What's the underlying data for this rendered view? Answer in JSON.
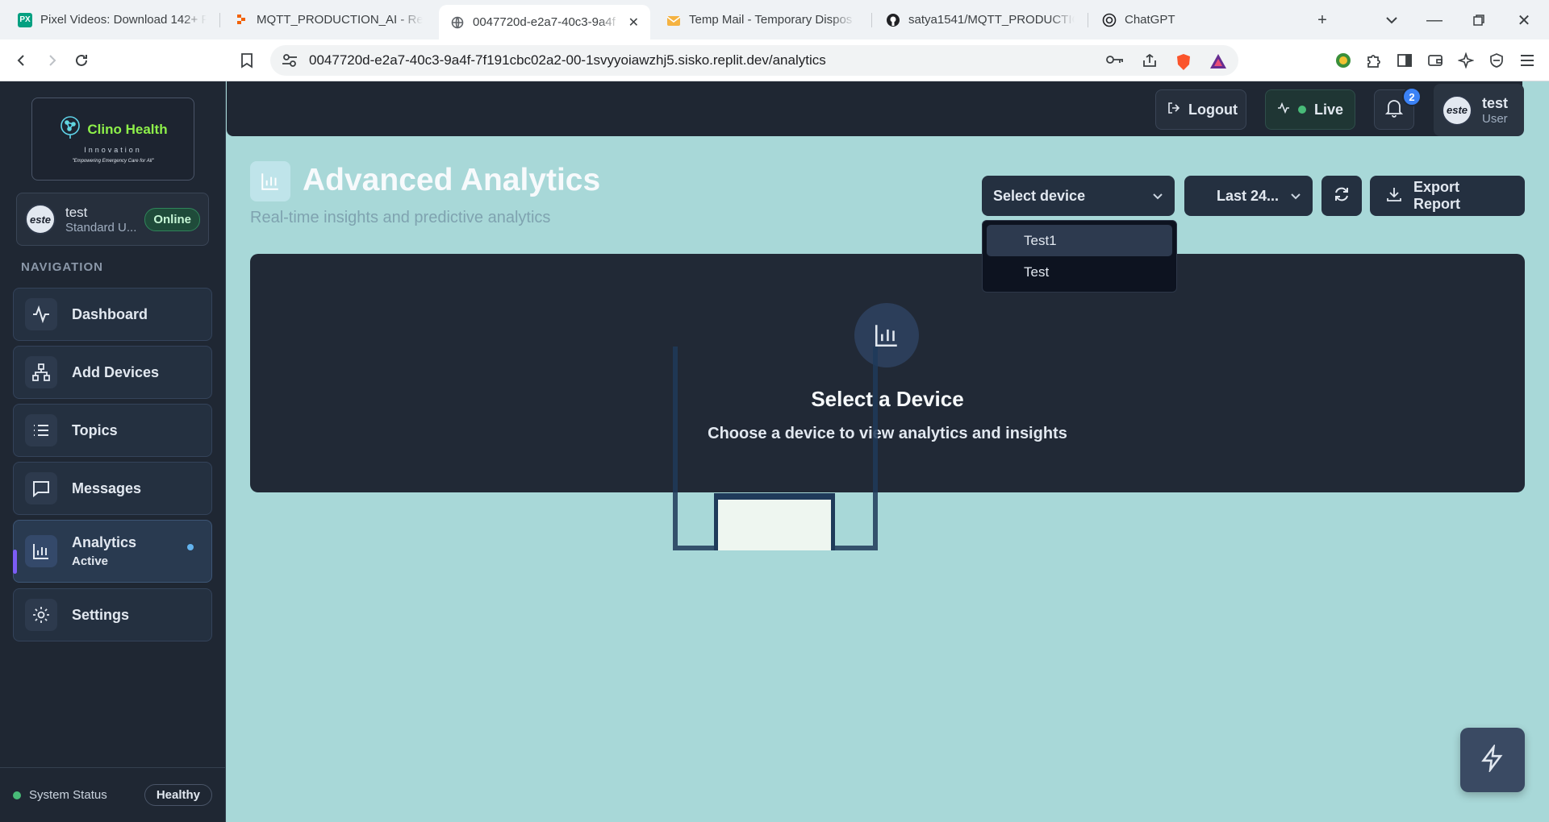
{
  "browser": {
    "tabs": [
      {
        "title": "Pixel Videos: Download 142+ Fr",
        "fav": "PX",
        "color": "#05a081"
      },
      {
        "title": "MQTT_PRODUCTION_AI - Repli",
        "fav": "",
        "color": "#f26207"
      },
      {
        "title": "0047720d-e2a7-40c3-9a4f",
        "fav": "",
        "color": "#5f6368"
      },
      {
        "title": "Temp Mail - Temporary Dispos",
        "fav": "",
        "color": "#f5b342"
      },
      {
        "title": "satya1541/MQTT_PRODUCTION",
        "fav": "",
        "color": "#202124"
      },
      {
        "title": "ChatGPT",
        "fav": "",
        "color": "#202124"
      }
    ],
    "url_main": "0047720d-e2a7-40c3-9a4f-7f191cbc02a2-00-1svyyoiawzhj5.sisko.replit.dev",
    "url_path": "/analytics"
  },
  "sidebar": {
    "logo": {
      "title": "Clino Health",
      "subtitle": "Innovation",
      "tagline": "\"Empowering Emergency Care for All\""
    },
    "user": {
      "avatar": "este",
      "name": "test",
      "role": "Standard U...",
      "status": "Online"
    },
    "nav_heading": "NAVIGATION",
    "items": [
      {
        "label": "Dashboard"
      },
      {
        "label": "Add Devices"
      },
      {
        "label": "Topics"
      },
      {
        "label": "Messages"
      },
      {
        "label": "Analytics",
        "sub": "Active"
      },
      {
        "label": "Settings"
      }
    ],
    "system_status": {
      "label": "System Status",
      "value": "Healthy"
    }
  },
  "topbar": {
    "logout": "Logout",
    "live": "Live",
    "notifications": "2",
    "user": {
      "avatar": "este",
      "name": "test",
      "role": "User"
    }
  },
  "page": {
    "title": "Advanced Analytics",
    "subtitle": "Real-time insights and predictive analytics"
  },
  "controls": {
    "device_select": "Select device",
    "range_select": "Last 24...",
    "export": "Export Report",
    "device_options": [
      "Test1",
      "Test"
    ]
  },
  "card": {
    "title": "Select a Device",
    "subtitle": "Choose a device to view analytics and insights"
  }
}
